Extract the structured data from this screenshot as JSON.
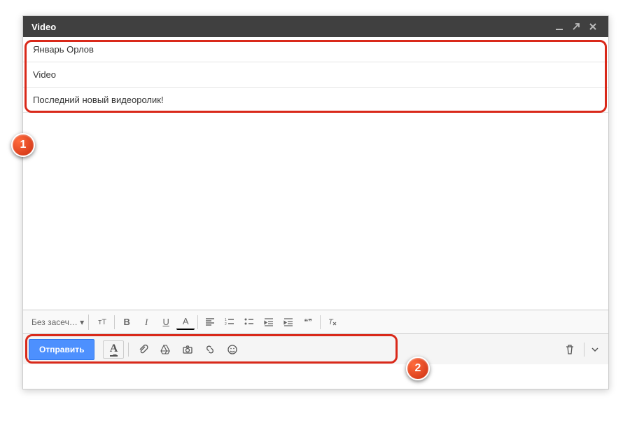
{
  "titlebar": {
    "title": "Video"
  },
  "header": {
    "to": "Январь Орлов",
    "subject": "Video",
    "body_first": "Последний новый видеоролик!"
  },
  "format": {
    "font_label": "Без засеч…",
    "size_label": "тТ",
    "bold": "B",
    "italic": "I",
    "underline": "U",
    "color": "A",
    "quote": "❝❞"
  },
  "bottom": {
    "send": "Отправить",
    "text_style": "A"
  },
  "callouts": {
    "one": "1",
    "two": "2"
  }
}
